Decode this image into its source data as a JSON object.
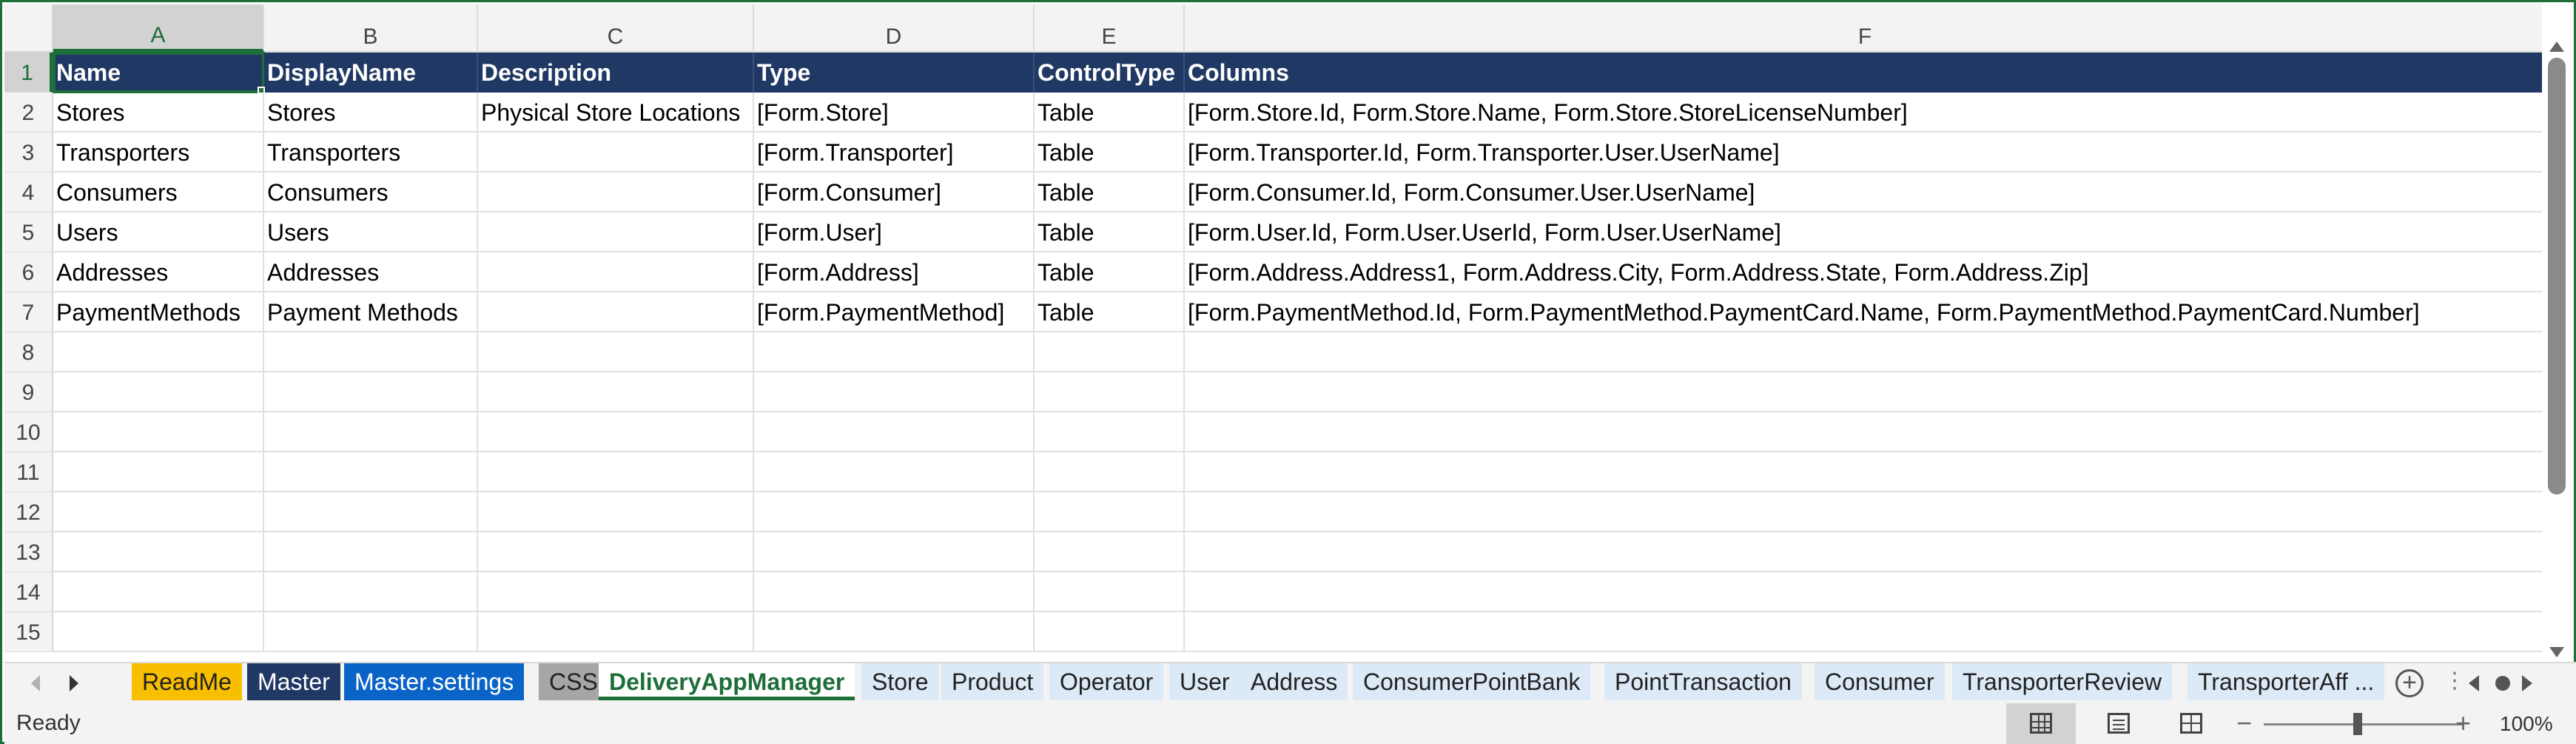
{
  "grid": {
    "columns": [
      "A",
      "B",
      "C",
      "D",
      "E",
      "F"
    ],
    "row_numbers": [
      "1",
      "2",
      "3",
      "4",
      "5",
      "6",
      "7",
      "8",
      "9",
      "10",
      "11",
      "12",
      "13",
      "14",
      "15"
    ],
    "header_row": [
      "Name",
      "DisplayName",
      "Description",
      "Type",
      "ControlType",
      "Columns"
    ],
    "data_rows": [
      [
        "Stores",
        "Stores",
        "Physical Store Locations",
        "[Form.Store]",
        "Table",
        "[Form.Store.Id, Form.Store.Name, Form.Store.StoreLicenseNumber]"
      ],
      [
        "Transporters",
        "Transporters",
        "",
        "[Form.Transporter]",
        "Table",
        "[Form.Transporter.Id, Form.Transporter.User.UserName]"
      ],
      [
        "Consumers",
        "Consumers",
        "",
        "[Form.Consumer]",
        "Table",
        "[Form.Consumer.Id, Form.Consumer.User.UserName]"
      ],
      [
        "Users",
        "Users",
        "",
        "[Form.User]",
        "Table",
        "[Form.User.Id, Form.User.UserId, Form.User.UserName]"
      ],
      [
        "Addresses",
        "Addresses",
        "",
        "[Form.Address]",
        "Table",
        "[Form.Address.Address1, Form.Address.City, Form.Address.State, Form.Address.Zip]"
      ],
      [
        "PaymentMethods",
        "Payment Methods",
        "",
        "[Form.PaymentMethod]",
        "Table",
        "[Form.PaymentMethod.Id,  Form.PaymentMethod.PaymentCard.Name, Form.PaymentMethod.PaymentCard.Number]"
      ]
    ],
    "header_color": "#203864",
    "selected_cell": "A1"
  },
  "sheet_tabs": [
    {
      "label": "ReadMe",
      "style": "yellow"
    },
    {
      "label": "Master",
      "style": "navy"
    },
    {
      "label": "Master.settings",
      "style": "blue"
    },
    {
      "label": "CSS",
      "style": "gray"
    },
    {
      "label": "DeliveryAppManager",
      "style": "active"
    },
    {
      "label": "Store",
      "style": "light"
    },
    {
      "label": "Product",
      "style": "light"
    },
    {
      "label": "Operator",
      "style": "light"
    },
    {
      "label": "User",
      "style": "light"
    },
    {
      "label": "Address",
      "style": "light"
    },
    {
      "label": "ConsumerPointBank",
      "style": "light"
    },
    {
      "label": "PointTransaction",
      "style": "light"
    },
    {
      "label": "Consumer",
      "style": "light"
    },
    {
      "label": "TransporterReview",
      "style": "light"
    },
    {
      "label": "TransporterAff ...",
      "style": "light"
    }
  ],
  "add_sheet_symbol": "+",
  "status": {
    "text": "Ready",
    "zoom_minus": "−",
    "zoom_plus": "+",
    "zoom_level": "100%"
  },
  "icons": {
    "normal_view": "grid-view-icon",
    "page_layout": "page-layout-icon",
    "page_break": "page-break-icon"
  }
}
